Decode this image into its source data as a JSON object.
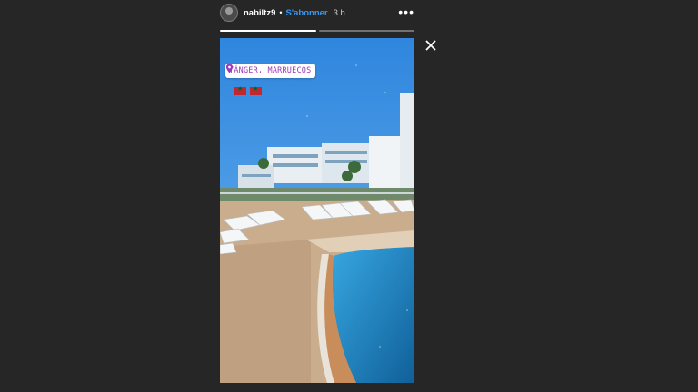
{
  "header": {
    "username": "nabiltz9",
    "separator": "•",
    "follow_label": "S'abonner",
    "time_ago": "3 h",
    "more_label": "•••"
  },
  "progress": [
    {
      "fill": 1.0
    },
    {
      "fill": 0.0
    }
  ],
  "story": {
    "location": "TÁNGER, MARRUECOS",
    "flag_emoji_count": 2,
    "flag_name": "morocco-flag"
  },
  "icons": {
    "close": "close-icon",
    "location": "location-pin-icon",
    "more": "more-options-icon"
  },
  "colors": {
    "background": "#262626",
    "follow_link": "#3897f0",
    "location_text": "#9b3ab8",
    "sky": "#2d8ae0",
    "pool_water": "#1d7fc0"
  }
}
